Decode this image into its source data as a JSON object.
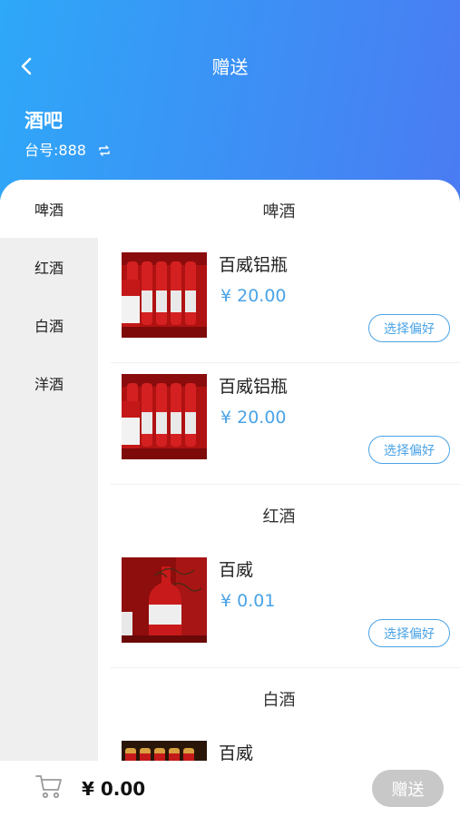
{
  "header": {
    "title": "赠送",
    "venue": "酒吧",
    "table_label": "台号:",
    "table_number": "888"
  },
  "sidebar": {
    "items": [
      {
        "label": "啤酒",
        "active": true
      },
      {
        "label": "红酒",
        "active": false
      },
      {
        "label": "白酒",
        "active": false
      },
      {
        "label": "洋酒",
        "active": false
      }
    ]
  },
  "categories": [
    {
      "title": "啤酒",
      "products": [
        {
          "name": "百威铝瓶",
          "price": "¥ 20.00",
          "action": "选择偏好",
          "image": "red-beer-bottles-photo"
        },
        {
          "name": "百威铝瓶",
          "price": "¥ 20.00",
          "action": "选择偏好",
          "image": "red-beer-bottles-photo"
        }
      ]
    },
    {
      "title": "红酒",
      "products": [
        {
          "name": "百威",
          "price": "¥ 0.01",
          "action": "选择偏好",
          "image": "red-bottle-with-plant-photo"
        }
      ]
    },
    {
      "title": "白酒",
      "products": [
        {
          "name": "百威",
          "price": "",
          "action": "",
          "image": "bottles-row-photo"
        }
      ]
    }
  ],
  "footer": {
    "total": "¥ 0.00",
    "submit_label": "赠送"
  },
  "icons": {
    "back": "chevron-left-icon",
    "swap": "swap-icon",
    "cart": "cart-icon"
  },
  "colors": {
    "header_start": "#2ea8f8",
    "header_end": "#4a7bf2",
    "accent": "#4aa3e6",
    "sidebar_bg": "#efefef",
    "submit_disabled": "#c8c8c8"
  }
}
